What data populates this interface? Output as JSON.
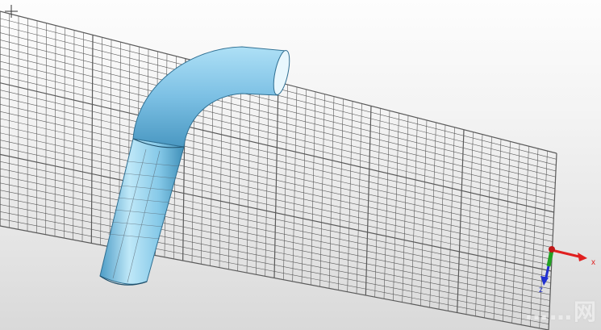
{
  "viewport": {
    "background_top": "#fdfdfd",
    "background_bottom": "#d9d9d9",
    "grid_color": "#5a5a5a",
    "pipe_color_light": "#bfe8f8",
    "pipe_color_mid": "#86c9e8",
    "pipe_color_dark": "#3f8fb8"
  },
  "axes": {
    "x_label": "x",
    "z_label": "z",
    "x_color": "#e02020",
    "y_color": "#22a022",
    "z_color": "#2030d0"
  },
  "cursor": {
    "icon": "crosshair-icon"
  },
  "watermark": {
    "text": "……网"
  }
}
